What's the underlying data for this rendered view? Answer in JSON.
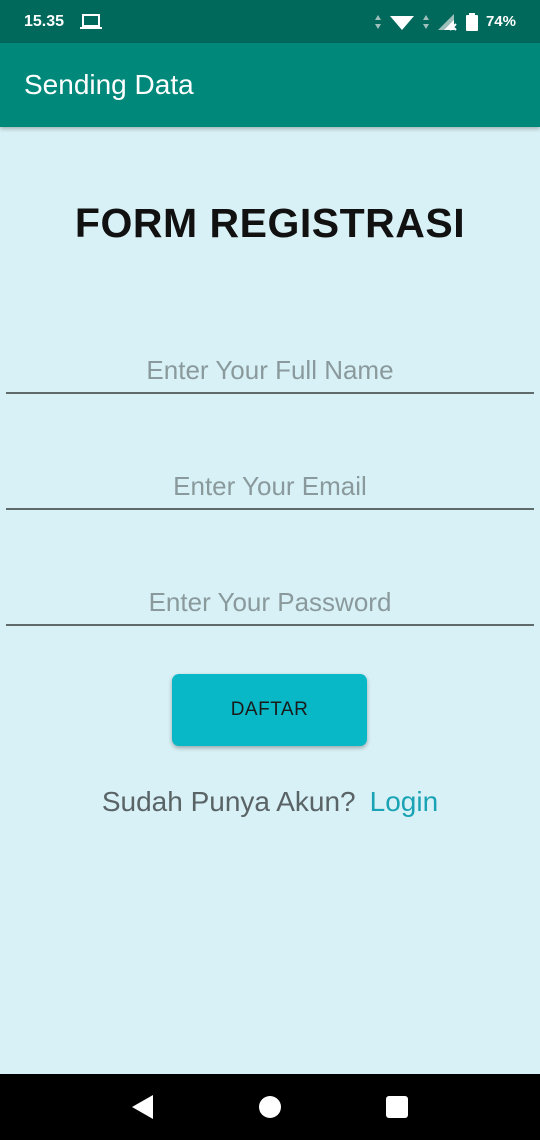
{
  "status_bar": {
    "time": "15.35",
    "battery": "74%"
  },
  "app_bar": {
    "title": "Sending Data"
  },
  "form": {
    "title": "FORM REGISTRASI",
    "name_placeholder": "Enter Your Full Name",
    "email_placeholder": "Enter Your Email",
    "password_placeholder": "Enter Your Password",
    "submit_label": "DAFTAR",
    "login_question": "Sudah Punya Akun?",
    "login_link": "Login"
  },
  "nav_bar": {
    "icons": [
      "back-icon",
      "home-icon",
      "recents-icon"
    ]
  },
  "colors": {
    "status_bar": "#00695c",
    "app_bar": "#00897b",
    "background": "#d8f1f6",
    "button": "#08b8c6",
    "link": "#1aa3b5"
  }
}
